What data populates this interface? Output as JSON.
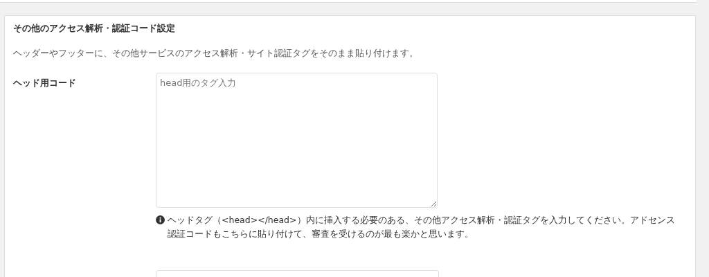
{
  "section": {
    "title": "その他のアクセス解析・認証コード設定",
    "description": "ヘッダーやフッターに、その他サービスのアクセス解析・サイト認証タグをそのまま貼り付けます。"
  },
  "fields": [
    {
      "label": "ヘッド用コード",
      "placeholder": "head用のタグ入力",
      "help": "ヘッドタグ（<head></head>）内に挿入する必要のある、その他アクセス解析・認証タグを入力してください。アドセンス認証コードもこちらに貼り付けて、審査を受けるのが最も楽かと思います。"
    }
  ]
}
